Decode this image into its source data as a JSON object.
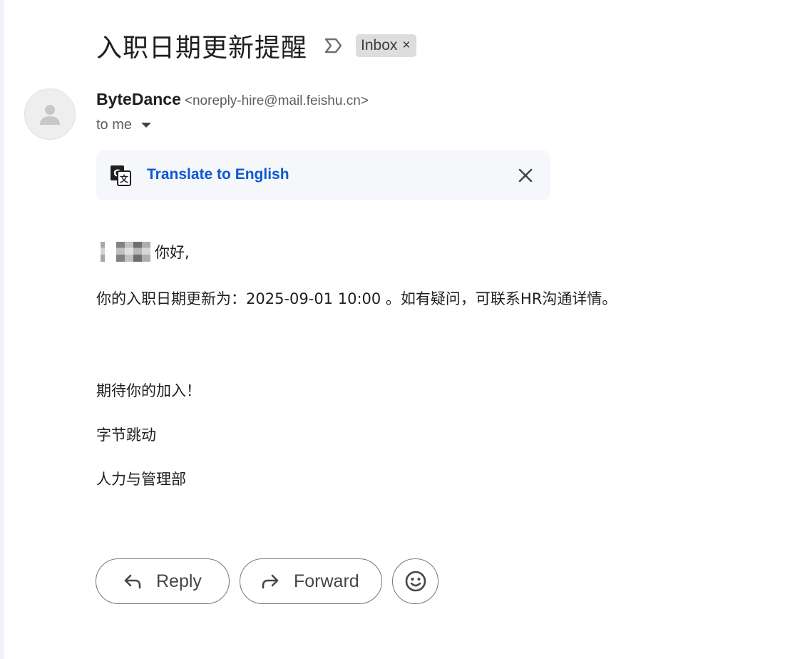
{
  "email": {
    "subject": "入职日期更新提醒",
    "labels": [
      {
        "name": "Inbox"
      }
    ],
    "sender": {
      "name": "ByteDance",
      "email": "<noreply-hire@mail.feishu.cn>"
    },
    "recipient_text": "to me",
    "translate_prompt": "Translate to English",
    "body": {
      "greeting": "你好,",
      "update_line": "你的入职日期更新为：2025-09-01 10:00 。如有疑问，可联系HR沟通详情。",
      "closing_lines": [
        "期待你的加入！",
        "字节跳动",
        "人力与管理部"
      ]
    }
  },
  "actions": {
    "reply_label": "Reply",
    "forward_label": "Forward"
  },
  "icons": {
    "importance": "label-important-outline-icon",
    "avatar": "default-person-avatar-icon",
    "translate": "translate-icon",
    "close": "close-icon",
    "reply": "reply-arrow-icon",
    "forward": "forward-arrow-icon",
    "emoji": "add-reaction-smiley-icon"
  },
  "colors": {
    "link": "#0b57d0",
    "chip_bg": "#dddddd",
    "translate_bar_bg": "#f5f7fb"
  }
}
